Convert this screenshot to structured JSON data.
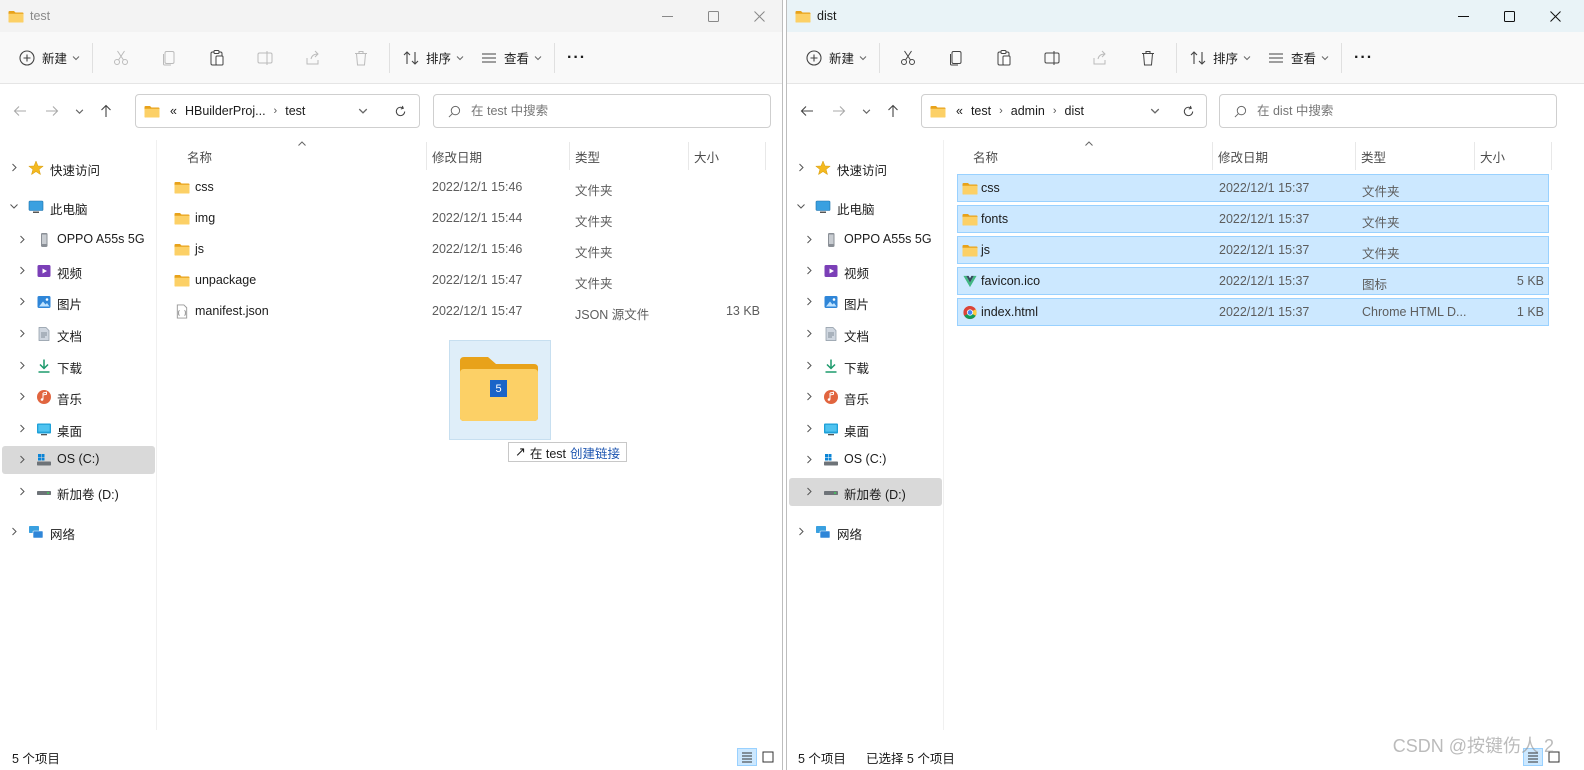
{
  "left": {
    "title": "test",
    "toolbar": {
      "new": "新建",
      "sort": "排序",
      "view": "查看",
      "more": "···"
    },
    "breadcrumb": {
      "overflow": "«",
      "items": [
        "HBuilderProj...",
        "test"
      ]
    },
    "search_placeholder": "在 test 中搜索",
    "columns": [
      "名称",
      "修改日期",
      "类型",
      "大小"
    ],
    "files": [
      {
        "name": "css",
        "date": "2022/12/1 15:46",
        "type": "文件夹",
        "size": "",
        "icon": "folder-icon"
      },
      {
        "name": "img",
        "date": "2022/12/1 15:44",
        "type": "文件夹",
        "size": "",
        "icon": "folder-icon"
      },
      {
        "name": "js",
        "date": "2022/12/1 15:46",
        "type": "文件夹",
        "size": "",
        "icon": "folder-icon"
      },
      {
        "name": "unpackage",
        "date": "2022/12/1 15:47",
        "type": "文件夹",
        "size": "",
        "icon": "folder-icon"
      },
      {
        "name": "manifest.json",
        "date": "2022/12/1 15:47",
        "type": "JSON 源文件",
        "size": "13 KB",
        "icon": "json-file-icon"
      }
    ],
    "status": "5 个项目",
    "selected_nav": "OS (C:)"
  },
  "right": {
    "title": "dist",
    "toolbar": {
      "new": "新建",
      "sort": "排序",
      "view": "查看",
      "more": "···"
    },
    "breadcrumb": {
      "overflow": "«",
      "items": [
        "test",
        "admin",
        "dist"
      ]
    },
    "search_placeholder": "在 dist 中搜索",
    "columns": [
      "名称",
      "修改日期",
      "类型",
      "大小"
    ],
    "files": [
      {
        "name": "css",
        "date": "2022/12/1 15:37",
        "type": "文件夹",
        "size": "",
        "icon": "folder-icon"
      },
      {
        "name": "fonts",
        "date": "2022/12/1 15:37",
        "type": "文件夹",
        "size": "",
        "icon": "folder-icon"
      },
      {
        "name": "js",
        "date": "2022/12/1 15:37",
        "type": "文件夹",
        "size": "",
        "icon": "folder-icon"
      },
      {
        "name": "favicon.ico",
        "date": "2022/12/1 15:37",
        "type": "图标",
        "size": "5 KB",
        "icon": "vue-logo-icon"
      },
      {
        "name": "index.html",
        "date": "2022/12/1 15:37",
        "type": "Chrome HTML D...",
        "size": "1 KB",
        "icon": "chrome-icon"
      }
    ],
    "status": "5 个项目",
    "status_selected": "已选择 5 个项目",
    "selected_nav": "新加卷 (D:)"
  },
  "nav_items": [
    {
      "label": "快速访问",
      "icon": "star-icon",
      "level": 0
    },
    {
      "label": "此电脑",
      "icon": "pc-icon",
      "level": 0,
      "expanded": true
    },
    {
      "label": "OPPO A55s 5G",
      "icon": "phone-icon",
      "level": 1
    },
    {
      "label": "视频",
      "icon": "video-icon",
      "level": 1
    },
    {
      "label": "图片",
      "icon": "pictures-icon",
      "level": 1
    },
    {
      "label": "文档",
      "icon": "documents-icon",
      "level": 1
    },
    {
      "label": "下载",
      "icon": "download-icon",
      "level": 1
    },
    {
      "label": "音乐",
      "icon": "music-icon",
      "level": 1
    },
    {
      "label": "桌面",
      "icon": "desktop-icon",
      "level": 1
    },
    {
      "label": "OS (C:)",
      "icon": "drive-c-icon",
      "level": 1
    },
    {
      "label": "新加卷 (D:)",
      "icon": "drive-d-icon",
      "level": 1
    },
    {
      "label": "网络",
      "icon": "network-icon",
      "level": 0
    }
  ],
  "drag": {
    "count": "5",
    "tip_prefix": "在 test",
    "tip_action": "创建链接",
    "tip_icon": "link-arrow-icon"
  },
  "watermark": "CSDN @按键伤人 2",
  "colors": {
    "selection": "#cce8ff",
    "selection_border": "#99d1ff",
    "folder": "#f8c74a",
    "accent": "#0067c0"
  }
}
